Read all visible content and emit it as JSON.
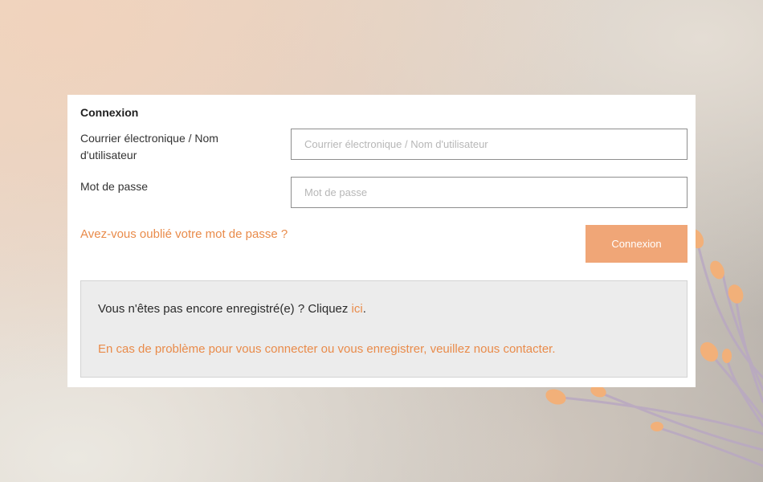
{
  "login": {
    "title": "Connexion",
    "email_label": "Courrier électronique / Nom d'utilisateur",
    "email_placeholder": "Courrier électronique / Nom d'utilisateur",
    "email_value": "",
    "password_label": "Mot de passe",
    "password_placeholder": "Mot de passe",
    "password_value": "",
    "forgot_link": "Avez-vous oublié votre mot de passe ?",
    "submit_label": "Connexion"
  },
  "register": {
    "prompt": "Vous n'êtes pas encore enregistré(e) ? Cliquez ",
    "link": "ici",
    "suffix": ".",
    "contact": "En cas de problème pour vous connecter ou vous enregistrer, veuillez nous contacter."
  },
  "colors": {
    "accent": "#e98b4a",
    "button": "#f0a677",
    "info_background": "#ececec"
  }
}
